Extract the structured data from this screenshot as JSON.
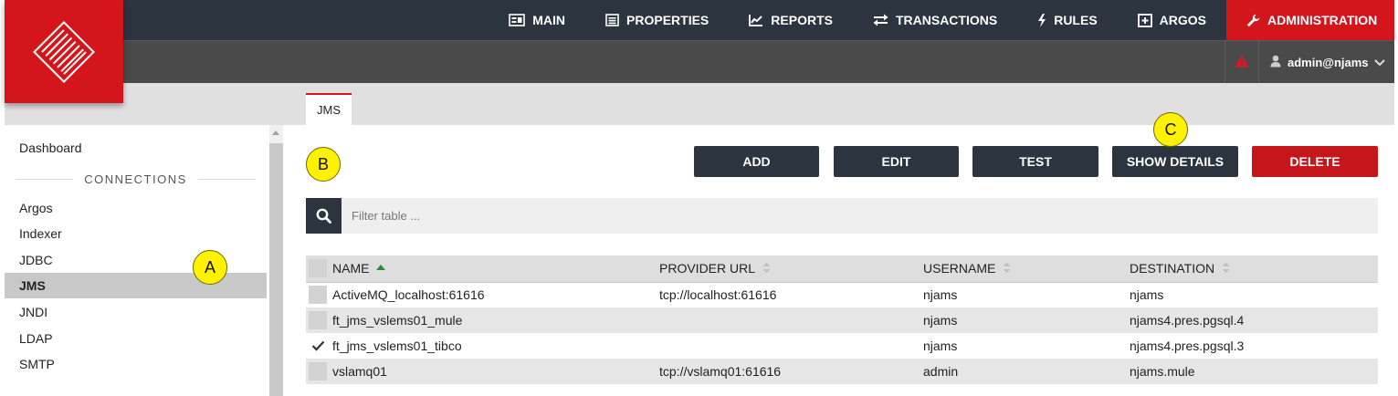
{
  "nav": {
    "items": [
      {
        "label": "MAIN",
        "icon": "main-icon"
      },
      {
        "label": "PROPERTIES",
        "icon": "properties-icon"
      },
      {
        "label": "REPORTS",
        "icon": "reports-icon"
      },
      {
        "label": "TRANSACTIONS",
        "icon": "transactions-icon"
      },
      {
        "label": "RULES",
        "icon": "rules-icon"
      },
      {
        "label": "ARGOS",
        "icon": "argos-icon"
      },
      {
        "label": "ADMINISTRATION",
        "icon": "wrench-icon"
      }
    ],
    "active_color": "#d4161c"
  },
  "user": {
    "name": "admin@njams"
  },
  "sidebar": {
    "dashboard": "Dashboard",
    "section_label": "CONNECTIONS",
    "items": [
      "Argos",
      "Indexer",
      "JDBC",
      "JMS",
      "JNDI",
      "LDAP",
      "SMTP"
    ],
    "selected": "JMS"
  },
  "tab": {
    "label": "JMS"
  },
  "toolbar": {
    "add": "ADD",
    "edit": "EDIT",
    "test": "TEST",
    "show_details": "SHOW DETAILS",
    "delete": "DELETE"
  },
  "search": {
    "placeholder": "Filter table ..."
  },
  "table": {
    "columns": [
      "NAME",
      "PROVIDER URL",
      "USERNAME",
      "DESTINATION"
    ],
    "rows": [
      {
        "name": "ActiveMQ_localhost:61616",
        "url": "tcp://localhost:61616",
        "username": "njams",
        "destination": "njams",
        "checked": false
      },
      {
        "name": "ft_jms_vslems01_mule",
        "url": "",
        "username": "njams",
        "destination": "njams4.pres.pgsql.4",
        "checked": false
      },
      {
        "name": "ft_jms_vslems01_tibco",
        "url": "",
        "username": "njams",
        "destination": "njams4.pres.pgsql.3",
        "checked": true
      },
      {
        "name": "vslamq01",
        "url": "tcp://vslamq01:61616",
        "username": "admin",
        "destination": "njams.mule",
        "checked": false
      }
    ]
  },
  "callouts": {
    "a": "A",
    "b": "B",
    "c": "C"
  },
  "colors": {
    "dark": "#2b343f",
    "brand_red": "#d4161c",
    "sort_green": "#2e8b3a",
    "callout_yellow": "#fff200"
  }
}
